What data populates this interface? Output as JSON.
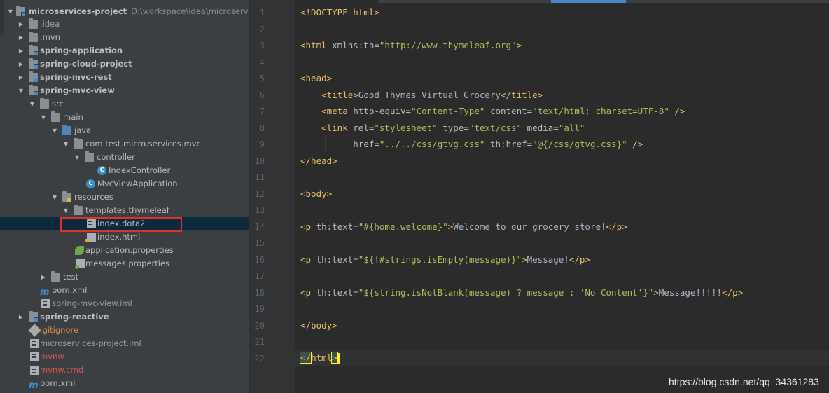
{
  "project_tree": {
    "root": {
      "label": "microservices-project",
      "path": "D:\\workspace\\idea\\microservices-pr"
    },
    "items": [
      {
        "label": ".idea"
      },
      {
        "label": ".mvn"
      },
      {
        "label": "spring-application"
      },
      {
        "label": "spring-cloud-project"
      },
      {
        "label": "spring-mvc-rest"
      },
      {
        "label": "spring-mvc-view"
      },
      {
        "label": "src"
      },
      {
        "label": "main"
      },
      {
        "label": "java"
      },
      {
        "label": "com.test.micro.services.mvc"
      },
      {
        "label": "controller"
      },
      {
        "label": "IndexController"
      },
      {
        "label": "MvcViewApplication"
      },
      {
        "label": "resources"
      },
      {
        "label": "templates.thymeleaf"
      },
      {
        "label": "index.dota2"
      },
      {
        "label": "index.html"
      },
      {
        "label": "application.properties"
      },
      {
        "label": "messages.properties"
      },
      {
        "label": "test"
      },
      {
        "label": "pom.xml"
      },
      {
        "label": "spring-mvc-view.iml"
      },
      {
        "label": "spring-reactive"
      },
      {
        "label": ".gitignore"
      },
      {
        "label": "microservices-project.iml"
      },
      {
        "label": "mvnw"
      },
      {
        "label": "mvnw.cmd"
      },
      {
        "label": "pom.xml"
      }
    ]
  },
  "editor": {
    "line_numbers": [
      "1",
      "2",
      "3",
      "4",
      "5",
      "6",
      "7",
      "8",
      "9",
      "10",
      "11",
      "12",
      "13",
      "14",
      "15",
      "16",
      "17",
      "18",
      "19",
      "20",
      "21",
      "22"
    ],
    "lines": {
      "l1": "<!DOCTYPE html>",
      "l3": [
        "<html ",
        "xmlns:th",
        "=",
        "\"http://www.thymeleaf.org\"",
        ">"
      ],
      "l5": "<head>",
      "l6": [
        "    <title>",
        "Good Thymes Virtual Grocery",
        "</title>"
      ],
      "l7": [
        "    <meta ",
        "http-equiv",
        "=",
        "\"Content-Type\"",
        " ",
        "content",
        "=",
        "\"text/html; charset=UTF-8\"",
        " />"
      ],
      "l8": [
        "    <link ",
        "rel",
        "=",
        "\"stylesheet\"",
        " ",
        "type",
        "=",
        "\"text/css\"",
        " ",
        "media",
        "=",
        "\"all\""
      ],
      "l9": [
        "          ",
        "href",
        "=",
        "\"../../css/gtvg.css\"",
        " ",
        "th:href",
        "=",
        "\"@{/css/gtvg.css}\"",
        " />"
      ],
      "l10": "</head>",
      "l12": "<body>",
      "l14": [
        "<p ",
        "th:text",
        "=",
        "\"#{home.welcome}\"",
        ">",
        "Welcome to our grocery store!",
        "</p>"
      ],
      "l16": [
        "<p ",
        "th:text",
        "=",
        "\"${!#strings.isEmpty(message)}\"",
        ">",
        "Message!",
        "</p>"
      ],
      "l18": [
        "<p ",
        "th:text",
        "=",
        "\"${string.isNotBlank(message) ? message : 'No Content'}\"",
        ">",
        "Message!!!!!",
        "</p>"
      ],
      "l20": "</body>",
      "l22_open": "</",
      "l22_name": "html",
      "l22_close": ">"
    }
  },
  "watermark": "https://blog.csdn.net/qq_34361283",
  "colors": {
    "tree_bg": "#3c3f41",
    "editor_bg": "#2b2b2b",
    "tag": "#e8bf6a",
    "attr_value": "#a5c25c",
    "selection": "#0d293e",
    "highlight_box": "#e0302a"
  }
}
